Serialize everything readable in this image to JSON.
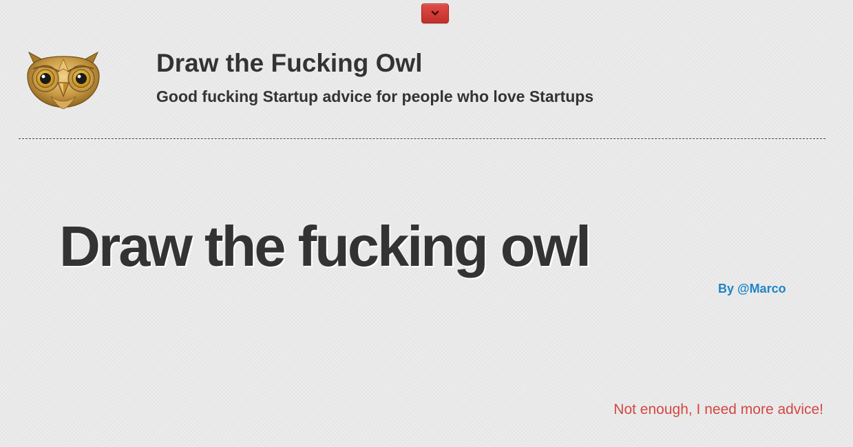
{
  "header": {
    "title": "Draw the Fucking Owl",
    "tagline": "Good fucking Startup advice for people who love Startups",
    "logo_icon": "owl-icon",
    "toggle_icon": "chevron-down-icon"
  },
  "main": {
    "advice": "Draw the fucking owl",
    "author_link": "By @Marco"
  },
  "footer": {
    "more_advice_link": "Not enough, I need more advice!"
  },
  "colors": {
    "toggle_button": "#d33c38",
    "link_blue": "#1e84c6",
    "link_red": "#d24743",
    "text": "#333333"
  }
}
